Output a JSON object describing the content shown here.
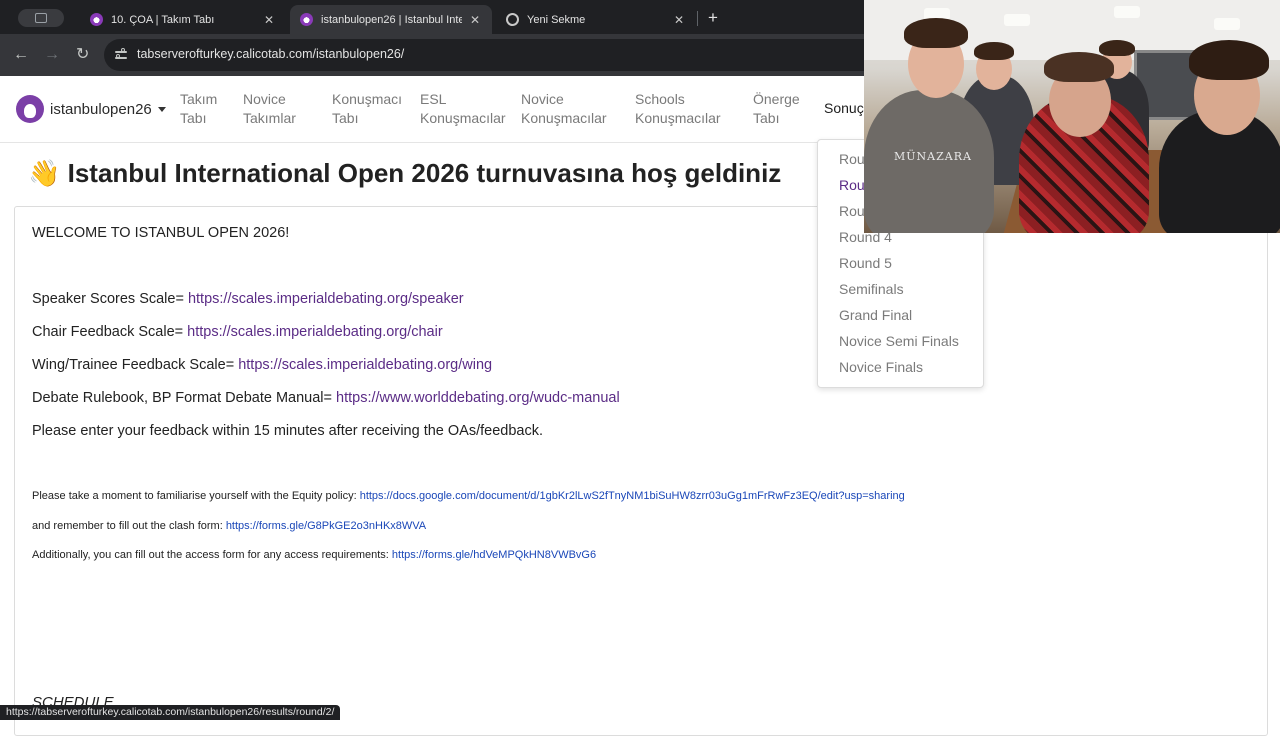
{
  "browser": {
    "tabs": [
      {
        "title": "10. ÇOA | Takım Tabı",
        "icon": "debate-logo-icon"
      },
      {
        "title": "istanbulopen26 | Istanbul Inte",
        "icon": "debate-logo-icon",
        "active": true
      },
      {
        "title": "Yeni Sekme",
        "icon": "chrome-icon"
      }
    ],
    "url": "tabserverofturkey.calicotab.com/istanbulopen26/",
    "status_url": "https://tabserverofturkey.calicotab.com/istanbulopen26/results/round/2/"
  },
  "site": {
    "brand": "istanbulopen26",
    "nav": [
      {
        "label": "Takım\nTabı"
      },
      {
        "label": "Novice\nTakımlar"
      },
      {
        "label": "Konuşmacı\nTabı"
      },
      {
        "label": "ESL\nKonuşmacılar"
      },
      {
        "label": "Novice\nKonuşmacılar"
      },
      {
        "label": "Schools\nKonuşmacılar"
      },
      {
        "label": "Önerge\nTabı"
      },
      {
        "label": "Sonuç"
      }
    ],
    "results_menu": [
      "Round 1",
      "Round 2",
      "Round 3",
      "Round 4",
      "Round 5",
      "Semifinals",
      "Grand Final",
      "Novice Semi Finals",
      "Novice Finals"
    ]
  },
  "main": {
    "title_emoji": "👋",
    "title": "Istanbul International Open 2026 turnuvasına hoş geldiniz",
    "welcome": "WELCOME TO ISTANBUL OPEN 2026!",
    "scales": [
      {
        "label": "Speaker Scores Scale= ",
        "link": "https://scales.imperialdebating.org/speaker"
      },
      {
        "label": "Chair Feedback Scale= ",
        "link": "https://scales.imperialdebating.org/chair"
      },
      {
        "label": "Wing/Trainee Feedback Scale= ",
        "link": "https://scales.imperialdebating.org/wing"
      },
      {
        "label": "Debate Rulebook, BP Format Debate Manual= ",
        "link": "https://www.worlddebating.org/wudc-manual"
      }
    ],
    "feedback_note": "Please enter your feedback within 15 minutes after receiving the OAs/feedback.",
    "equity": {
      "label": "Please take a moment to familiarise yourself with the Equity policy: ",
      "link": "https://docs.google.com/document/d/1gbKr2lLwS2fTnyNM1biSuHW8zrr03uGg1mFrRwFz3EQ/edit?usp=sharing"
    },
    "clash": {
      "label": "and remember to fill out the clash form: ",
      "link": "https://forms.gle/G8PkGE2o3nHKx8WVA"
    },
    "access": {
      "label": "Additionally, you can fill out the access form for any access requirements: ",
      "link": "https://forms.gle/hdVeMPQkHN8VWBvG6"
    },
    "schedule": "SCHEDULE"
  },
  "webcam": {
    "shirt_text": "MÜNAZARA"
  }
}
